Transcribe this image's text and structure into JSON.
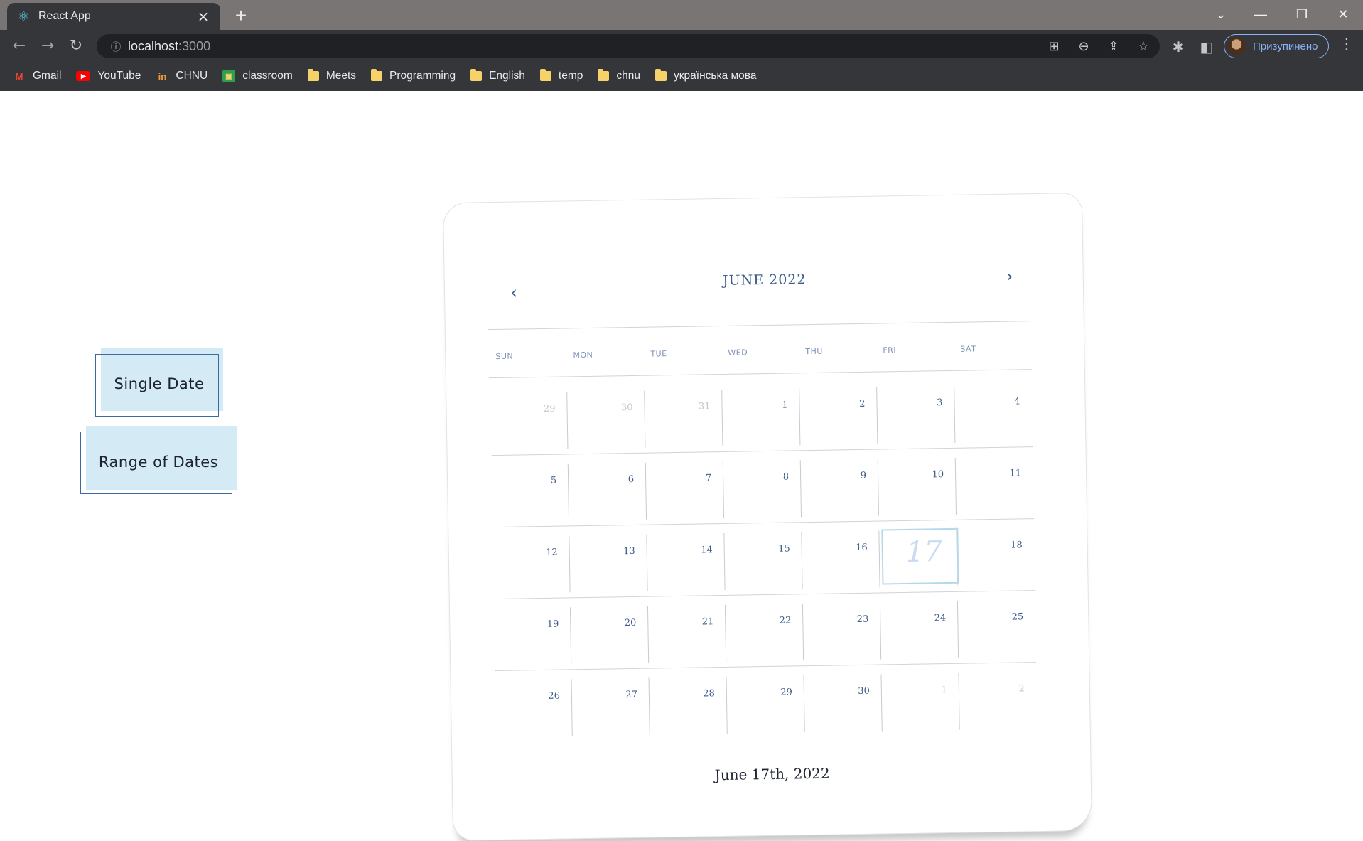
{
  "browser": {
    "tab_title": "React App",
    "url_host": "localhost",
    "url_port": ":3000",
    "profile_label": "Призупинено",
    "bookmarks": [
      {
        "label": "Gmail",
        "icon": "gmail-icon"
      },
      {
        "label": "YouTube",
        "icon": "youtube-icon"
      },
      {
        "label": "CHNU",
        "icon": "chnu-icon"
      },
      {
        "label": "classroom",
        "icon": "classroom-icon"
      },
      {
        "label": "Meets",
        "icon": "folder-icon"
      },
      {
        "label": "Programming",
        "icon": "folder-icon"
      },
      {
        "label": "English",
        "icon": "folder-icon"
      },
      {
        "label": "temp",
        "icon": "folder-icon"
      },
      {
        "label": "chnu",
        "icon": "folder-icon"
      },
      {
        "label": "українська мова",
        "icon": "folder-icon"
      }
    ]
  },
  "mode_buttons": {
    "single": "Single Date",
    "range": "Range of Dates"
  },
  "calendar": {
    "title": "JUNE 2022",
    "prev_icon": "‹",
    "next_icon": "›",
    "weekdays": [
      "SUN",
      "MON",
      "TUE",
      "WED",
      "THU",
      "FRI",
      "SAT"
    ],
    "weeks": [
      [
        {
          "d": "29",
          "muted": true
        },
        {
          "d": "30",
          "muted": true
        },
        {
          "d": "31",
          "muted": true
        },
        {
          "d": "1"
        },
        {
          "d": "2"
        },
        {
          "d": "3"
        },
        {
          "d": "4"
        }
      ],
      [
        {
          "d": "5"
        },
        {
          "d": "6"
        },
        {
          "d": "7"
        },
        {
          "d": "8"
        },
        {
          "d": "9"
        },
        {
          "d": "10"
        },
        {
          "d": "11"
        }
      ],
      [
        {
          "d": "12"
        },
        {
          "d": "13"
        },
        {
          "d": "14"
        },
        {
          "d": "15"
        },
        {
          "d": "16"
        },
        {
          "d": "17",
          "selected": true
        },
        {
          "d": "18"
        }
      ],
      [
        {
          "d": "19"
        },
        {
          "d": "20"
        },
        {
          "d": "21"
        },
        {
          "d": "22"
        },
        {
          "d": "23"
        },
        {
          "d": "24"
        },
        {
          "d": "25"
        }
      ],
      [
        {
          "d": "26"
        },
        {
          "d": "27"
        },
        {
          "d": "28"
        },
        {
          "d": "29"
        },
        {
          "d": "30"
        },
        {
          "d": "1",
          "muted": true
        },
        {
          "d": "2",
          "muted": true
        }
      ]
    ],
    "selected_text": "June 17th, 2022"
  }
}
